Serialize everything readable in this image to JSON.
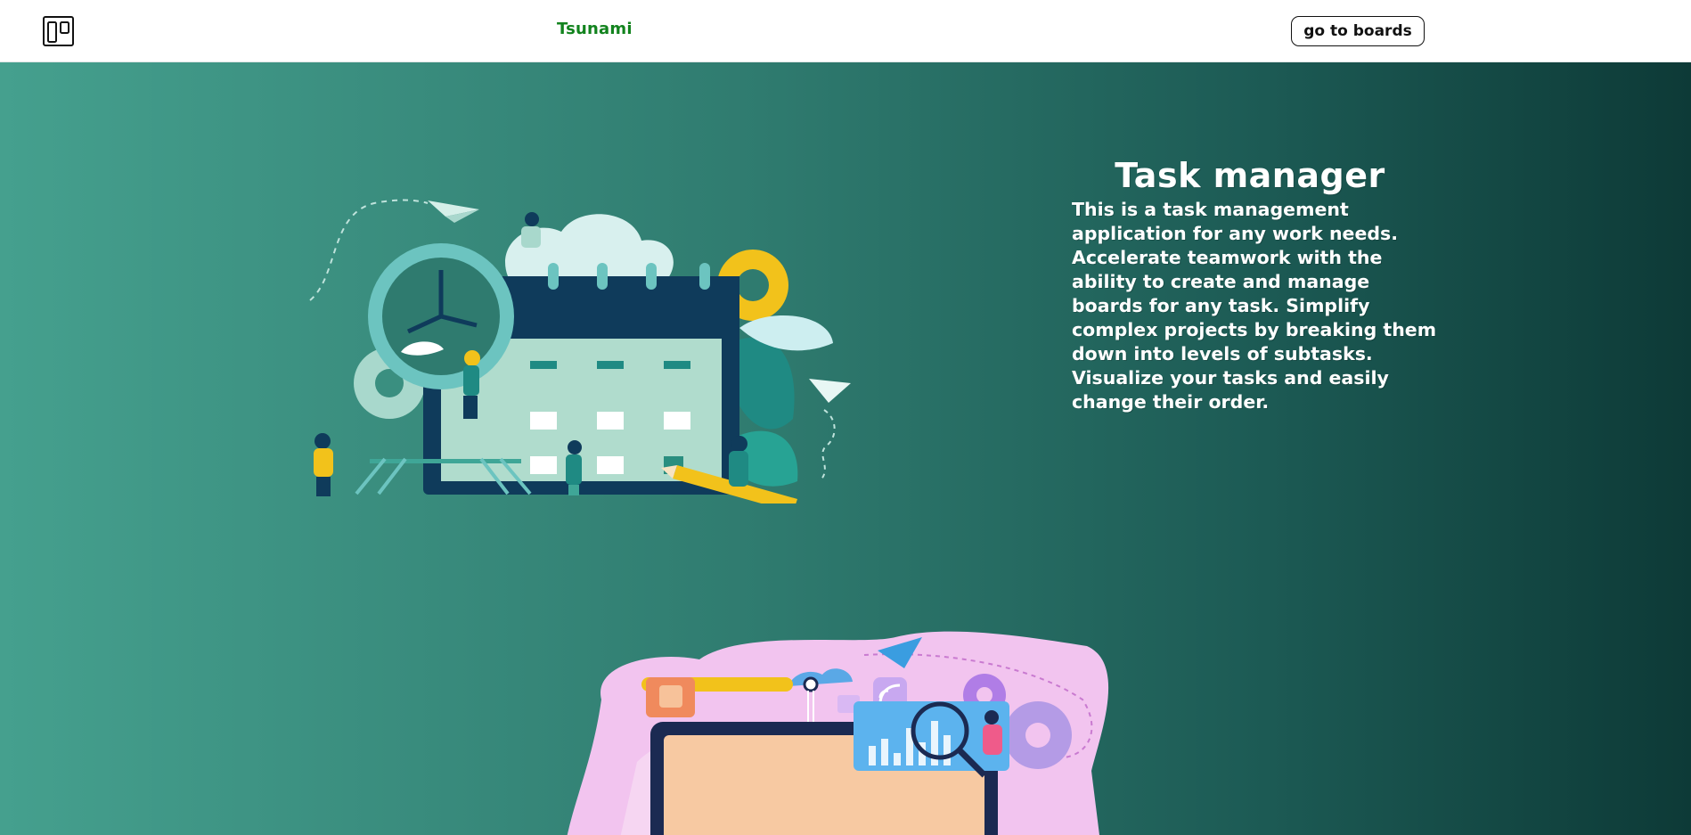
{
  "header": {
    "logo_icon": "boards-icon",
    "brand": "Tsunami",
    "brand_color": "#12831e",
    "go_to_boards_label": "go to boards"
  },
  "hero": {
    "title": "Task manager",
    "description": "This is a task management application for any work needs. Accelerate teamwork with the ability to create and manage boards for any task. Simplify complex projects by breaking them down into levels of subtasks. Visualize your tasks and easily change their order.",
    "gradient_start": "#45a08e",
    "gradient_end": "#0d3a37",
    "illustration_1": "calendar-team-illustration",
    "illustration_2": "dashboard-analytics-illustration"
  }
}
